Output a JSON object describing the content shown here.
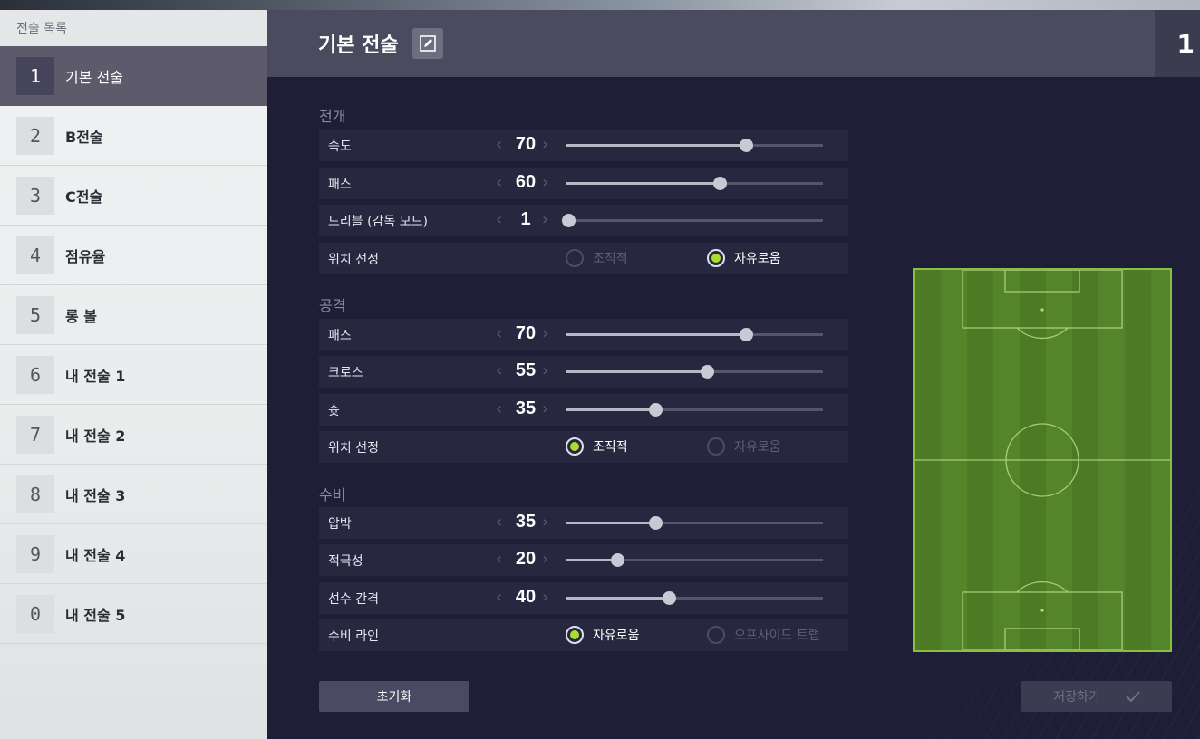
{
  "sidebar": {
    "header": "전술 목록",
    "items": [
      {
        "num": "1",
        "label": "기본 전술"
      },
      {
        "num": "2",
        "label": "B전술"
      },
      {
        "num": "3",
        "label": "C전술"
      },
      {
        "num": "4",
        "label": "점유율"
      },
      {
        "num": "5",
        "label": "롱 볼"
      },
      {
        "num": "6",
        "label": "내 전술 1"
      },
      {
        "num": "7",
        "label": "내 전술 2"
      },
      {
        "num": "8",
        "label": "내 전술 3"
      },
      {
        "num": "9",
        "label": "내 전술 4"
      },
      {
        "num": "0",
        "label": "내 전술 5"
      }
    ],
    "active_index": 0
  },
  "header": {
    "title": "기본 전술",
    "tactic_number": "1"
  },
  "sections": {
    "buildup": {
      "title": "전개",
      "speed": {
        "label": "속도",
        "value": "70"
      },
      "passing": {
        "label": "패스",
        "value": "60"
      },
      "dribbling": {
        "label": "드리블 (감독 모드)",
        "value": "1"
      },
      "positioning": {
        "label": "위치 선정",
        "option1": "조직적",
        "option2": "자유로움",
        "selected": "option2"
      }
    },
    "attack": {
      "title": "공격",
      "passing": {
        "label": "패스",
        "value": "70"
      },
      "crossing": {
        "label": "크로스",
        "value": "55"
      },
      "shooting": {
        "label": "슛",
        "value": "35"
      },
      "positioning": {
        "label": "위치 선정",
        "option1": "조직적",
        "option2": "자유로움",
        "selected": "option1"
      }
    },
    "defence": {
      "title": "수비",
      "pressure": {
        "label": "압박",
        "value": "35"
      },
      "aggression": {
        "label": "적극성",
        "value": "20"
      },
      "width": {
        "label": "선수 간격",
        "value": "40"
      },
      "line": {
        "label": "수비 라인",
        "option1": "자유로움",
        "option2": "오프사이드 트랩",
        "selected": "option1"
      }
    }
  },
  "buttons": {
    "reset": "초기화",
    "save": "저장하기"
  },
  "colors": {
    "accent": "#a7e02a",
    "pitch_light": "#55852a",
    "pitch_dark": "#4d7a24"
  }
}
